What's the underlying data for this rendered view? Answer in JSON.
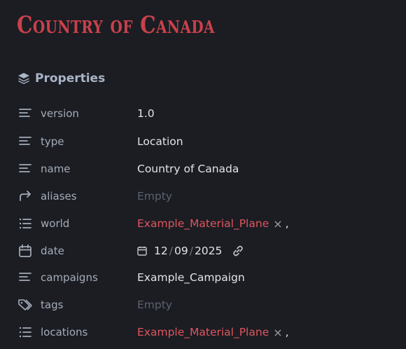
{
  "page": {
    "title": "Country of Canada"
  },
  "properties": {
    "header": "Properties",
    "rows": [
      {
        "key": "version",
        "value": "1.0",
        "icon": "text-lines-icon"
      },
      {
        "key": "type",
        "value": "Location",
        "icon": "text-lines-icon"
      },
      {
        "key": "name",
        "value": "Country of Canada",
        "icon": "text-lines-icon"
      },
      {
        "key": "aliases",
        "value": "Empty",
        "icon": "forward-arrow-icon"
      },
      {
        "key": "world",
        "value": "Example_Material_Plane",
        "icon": "list-icon",
        "remove": "×",
        "sep": ","
      },
      {
        "key": "date",
        "icon": "calendar-icon",
        "day": "12",
        "month": "09",
        "year": "2025",
        "slash": "/"
      },
      {
        "key": "campaigns",
        "value": "Example_Campaign",
        "icon": "text-lines-icon"
      },
      {
        "key": "tags",
        "value": "Empty",
        "icon": "tags-icon"
      },
      {
        "key": "locations",
        "value": "Example_Material_Plane",
        "icon": "list-icon",
        "remove": "×",
        "sep": ","
      }
    ]
  },
  "colors": {
    "accent": "#c9414a",
    "link": "#e0555e",
    "background": "#1b1d23"
  }
}
